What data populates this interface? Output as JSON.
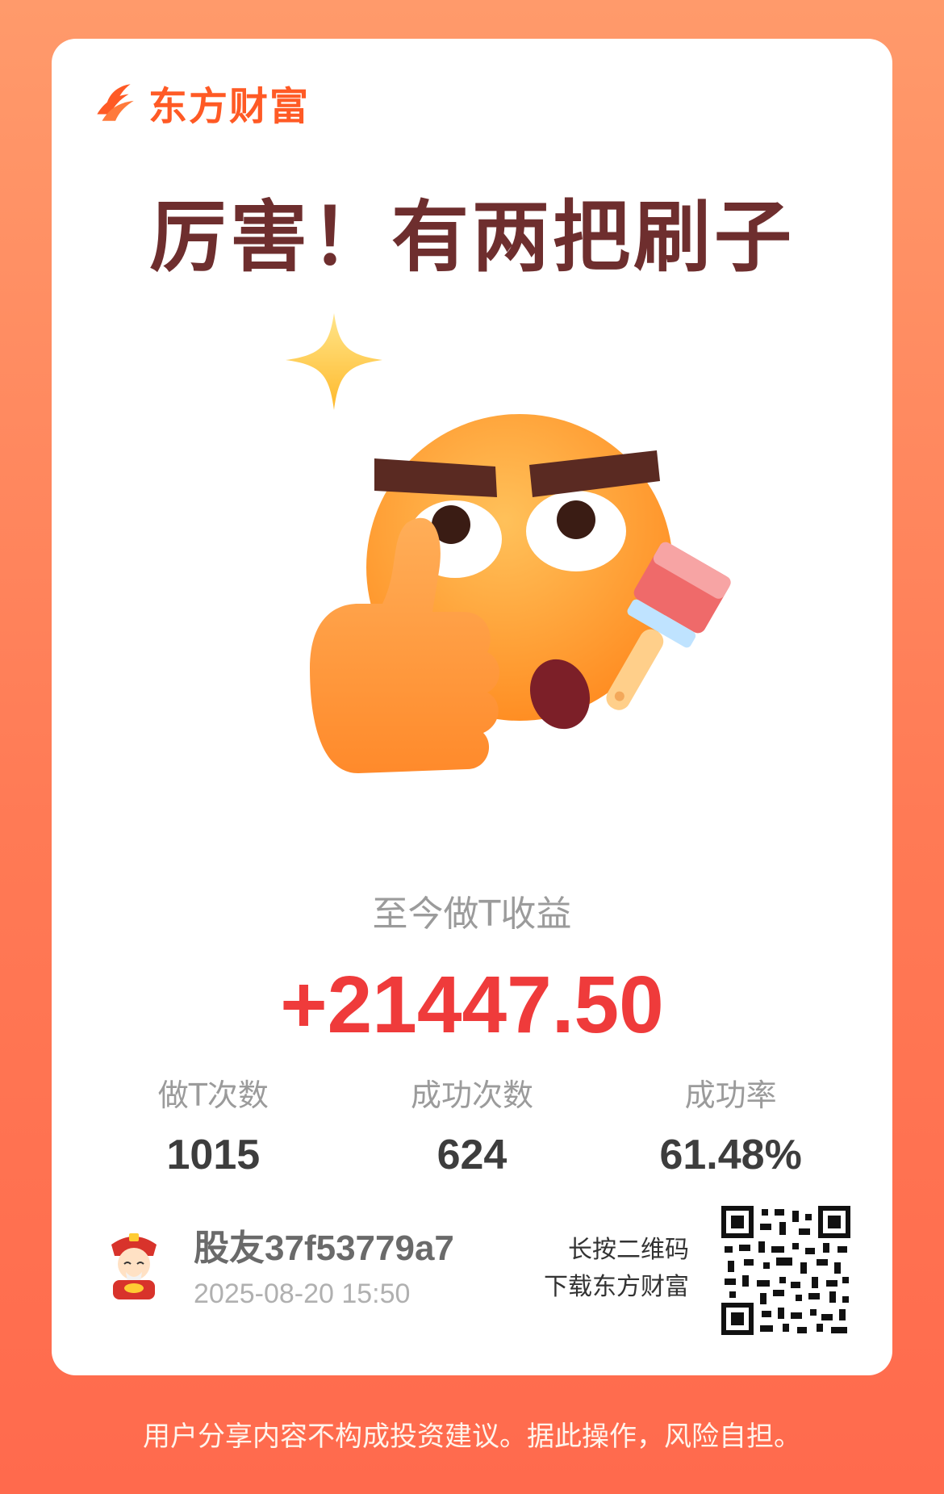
{
  "brand": {
    "name": "东方财富",
    "logo_icon": "east-money-flame-logo",
    "color": "#ff5a25"
  },
  "headline": "厉害！有两把刷子",
  "illustration": {
    "icon": "thumbs-up-paintbrush-emoji"
  },
  "profit": {
    "title": "至今做T收益",
    "value": "+21447.50",
    "color": "#ef3b3b"
  },
  "stats": [
    {
      "label": "做T次数",
      "value": "1015"
    },
    {
      "label": "成功次数",
      "value": "624"
    },
    {
      "label": "成功率",
      "value": "61.48%"
    }
  ],
  "user": {
    "name": "股友37f53779a7",
    "timestamp": "2025-08-20 15:50",
    "avatar_icon": "caishen-avatar"
  },
  "qr": {
    "hint_line1": "长按二维码",
    "hint_line2": "下载东方财富",
    "icon": "qr-code"
  },
  "disclaimer": "用户分享内容不构成投资建议。据此操作，风险自担。"
}
